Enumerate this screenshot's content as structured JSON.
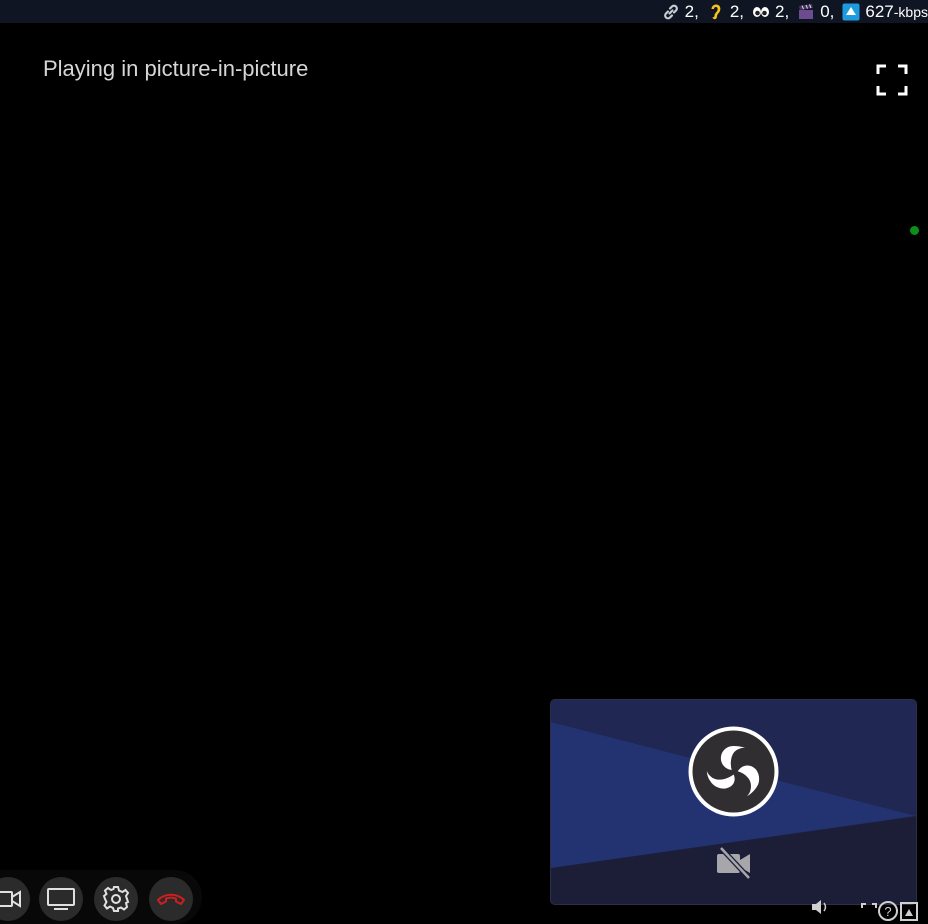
{
  "stats": {
    "connections": "2,",
    "listeners": "2,",
    "viewers": "2,",
    "scenes": "0,",
    "bitrate": "627",
    "bitrate_unit": "-kbps",
    "icons": [
      "link-icon",
      "ear-icon",
      "eyes-icon",
      "clapper-icon",
      "upload-arrow-icon"
    ]
  },
  "pip": {
    "message": "Playing in picture-in-picture"
  },
  "colors": {
    "topbar_bg": "#0f1522",
    "preview_dark": "#1c1e38",
    "preview_blue": "#233371",
    "status_dot": "#0a8f1a",
    "hangup_red": "#cc1f1f"
  },
  "controls": {
    "buttons": [
      "camera-icon",
      "screen-share-icon",
      "settings-icon",
      "hangup-icon"
    ]
  }
}
